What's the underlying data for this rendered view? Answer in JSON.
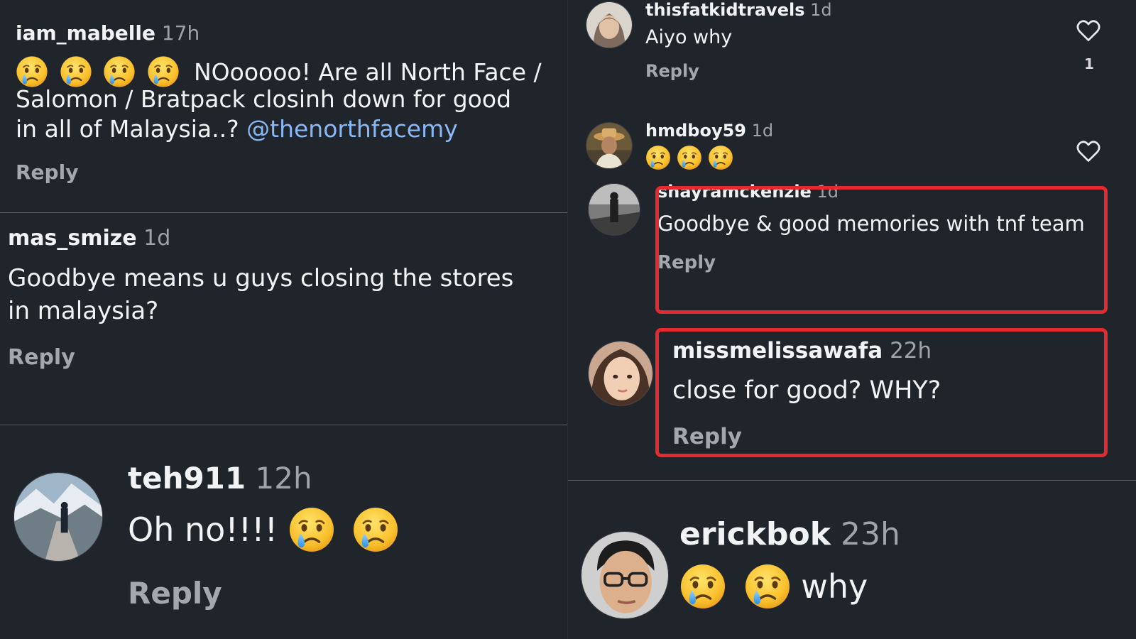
{
  "comments_left": [
    {
      "username": "iam_mabelle",
      "time": "17h",
      "text_line1": "NOooooo! Are all North Face /",
      "text_line2": "Salomon / Bratpack closinh down for good",
      "text_line3": "in all of Malaysia..?",
      "mention": "@thenorthfacemy",
      "reply": "Reply",
      "emojis": [
        "crying-face",
        "crying-face",
        "crying-face",
        "crying-face"
      ]
    },
    {
      "username": "mas_smize",
      "time": "1d",
      "text_line1": "Goodbye means u guys closing the stores",
      "text_line2": "in malaysia?",
      "reply": "Reply"
    },
    {
      "username": "teh911",
      "time": "12h",
      "text": "Oh no!!!!",
      "reply": "Reply",
      "emojis": [
        "crying-face",
        "crying-face"
      ]
    }
  ],
  "comments_right": [
    {
      "username": "thisfatkidtravels",
      "time": "1d",
      "text": "Aiyo why",
      "reply": "Reply",
      "likes": "1"
    },
    {
      "username": "hmdboy59",
      "time": "1d",
      "emojis": [
        "crying-face",
        "crying-face",
        "crying-face"
      ]
    },
    {
      "username": "shayramckenzie",
      "time": "1d",
      "text": "Goodbye & good memories with tnf team",
      "reply": "Reply"
    },
    {
      "username": "missmelissawafa",
      "time": "22h",
      "text": "close for good? WHY?",
      "reply": "Reply"
    },
    {
      "username": "erickbok",
      "time": "23h",
      "text": "why",
      "emojis": [
        "crying-face",
        "crying-face"
      ]
    }
  ],
  "colors": {
    "background": "#20242b",
    "mention": "#8ab8f5",
    "highlight": "#e52a2f"
  }
}
